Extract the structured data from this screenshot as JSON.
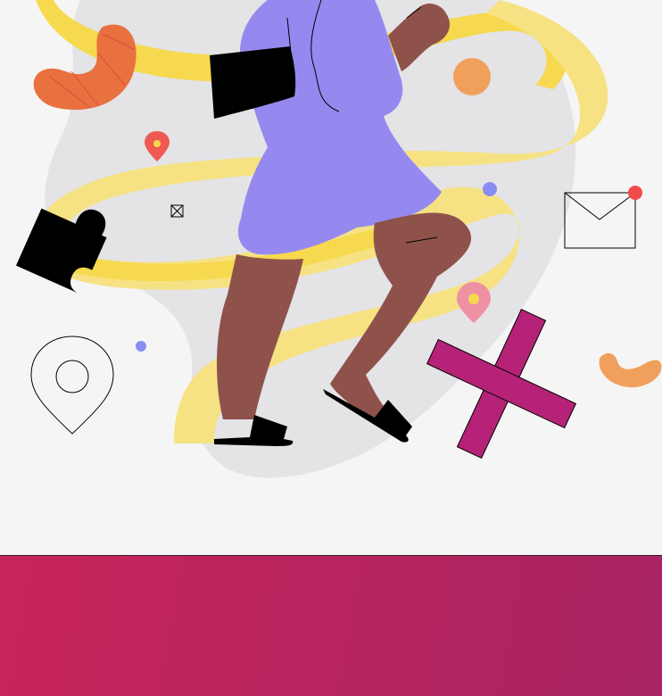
{
  "colors": {
    "background": "#f5f5f5",
    "blob": "#e4e3e6",
    "ribbon_light": "#f6e283",
    "ribbon_dark": "#f6d94e",
    "dress": "#9589f0",
    "skin": "#8e524b",
    "black": "#000000",
    "croissant": "#e9713f",
    "orange_dot": "#f0a05c",
    "pin_red": "#ee5a52",
    "pin_pink": "#f091a3",
    "cross": "#b52277",
    "dot_blue": "#8a8cf2",
    "notification_dot": "#ee4b4b",
    "band_start": "#c7245a",
    "band_end": "#a82462"
  },
  "icons": [
    "puzzle-piece-icon",
    "location-pin-outline-icon",
    "envelope-icon",
    "location-pin-red-icon",
    "location-pin-pink-icon",
    "close-box-icon",
    "plus-cross-icon"
  ]
}
